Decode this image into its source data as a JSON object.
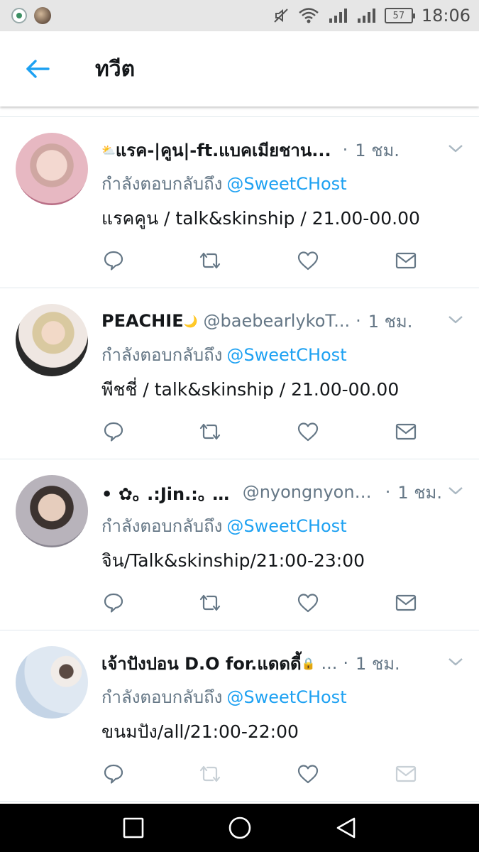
{
  "status_bar": {
    "time": "18:06",
    "battery": "57",
    "icons": [
      "app-notification-icon",
      "avatar-notification-icon",
      "mute-icon",
      "wifi-icon",
      "signal-icon",
      "signal-icon-2",
      "battery-icon"
    ]
  },
  "header": {
    "title": "ทวีต",
    "back_icon": "arrow-left-icon",
    "accent": "#1da1f2"
  },
  "tweets": [
    {
      "name": "แรค-|คูน|-ft.แบคเมียชาน...",
      "name_emoji": "⛅",
      "handle": "",
      "sep": "·",
      "time": "1 ชม.",
      "reply_prefix": "กำลังตอบกลับถึง",
      "mention": "@SweetCHost",
      "text": "แรคคูน / talk&skinship / 21.00-00.00"
    },
    {
      "name": "PEACHIE",
      "name_emoji": "🌙",
      "handle": "@baebearlykoT...",
      "sep": "·",
      "time": "1 ชม.",
      "reply_prefix": "กำลังตอบกลับถึง",
      "mention": "@SweetCHost",
      "text": "พีชชี่ / talk&skinship / 21.00-00.00"
    },
    {
      "name": "• ✿｡ .:Jin.:｡ ✿•",
      "name_emoji": "",
      "handle": "@nyongnyongyi",
      "sep": "·",
      "time": "1 ชม.",
      "reply_prefix": "กำลังตอบกลับถึง",
      "mention": "@SweetCHost",
      "text": "จิน/Talk&skinship/21:00-23:00"
    },
    {
      "name": "เจ้าปังปอน D.O for.แดดดี้",
      "name_emoji": "🔒",
      "handle": "...",
      "sep": "·",
      "time": "1 ชม.",
      "reply_prefix": "กำลังตอบกลับถึง",
      "mention": "@SweetCHost",
      "text": "ขนมปัง/all/21:00-22:00"
    }
  ],
  "actions": [
    "reply-icon",
    "retweet-icon",
    "like-icon",
    "dm-icon"
  ],
  "nav_bar": [
    "recent-apps-icon",
    "home-icon",
    "back-icon"
  ]
}
